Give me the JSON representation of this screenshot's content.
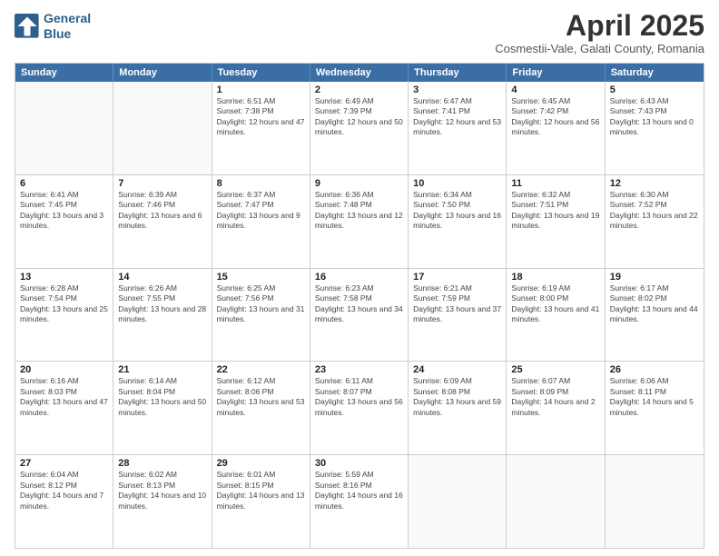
{
  "logo": {
    "line1": "General",
    "line2": "Blue"
  },
  "title": "April 2025",
  "subtitle": "Cosmestii-Vale, Galati County, Romania",
  "header_days": [
    "Sunday",
    "Monday",
    "Tuesday",
    "Wednesday",
    "Thursday",
    "Friday",
    "Saturday"
  ],
  "weeks": [
    [
      {
        "day": "",
        "text": ""
      },
      {
        "day": "",
        "text": ""
      },
      {
        "day": "1",
        "text": "Sunrise: 6:51 AM\nSunset: 7:38 PM\nDaylight: 12 hours and 47 minutes."
      },
      {
        "day": "2",
        "text": "Sunrise: 6:49 AM\nSunset: 7:39 PM\nDaylight: 12 hours and 50 minutes."
      },
      {
        "day": "3",
        "text": "Sunrise: 6:47 AM\nSunset: 7:41 PM\nDaylight: 12 hours and 53 minutes."
      },
      {
        "day": "4",
        "text": "Sunrise: 6:45 AM\nSunset: 7:42 PM\nDaylight: 12 hours and 56 minutes."
      },
      {
        "day": "5",
        "text": "Sunrise: 6:43 AM\nSunset: 7:43 PM\nDaylight: 13 hours and 0 minutes."
      }
    ],
    [
      {
        "day": "6",
        "text": "Sunrise: 6:41 AM\nSunset: 7:45 PM\nDaylight: 13 hours and 3 minutes."
      },
      {
        "day": "7",
        "text": "Sunrise: 6:39 AM\nSunset: 7:46 PM\nDaylight: 13 hours and 6 minutes."
      },
      {
        "day": "8",
        "text": "Sunrise: 6:37 AM\nSunset: 7:47 PM\nDaylight: 13 hours and 9 minutes."
      },
      {
        "day": "9",
        "text": "Sunrise: 6:36 AM\nSunset: 7:48 PM\nDaylight: 13 hours and 12 minutes."
      },
      {
        "day": "10",
        "text": "Sunrise: 6:34 AM\nSunset: 7:50 PM\nDaylight: 13 hours and 16 minutes."
      },
      {
        "day": "11",
        "text": "Sunrise: 6:32 AM\nSunset: 7:51 PM\nDaylight: 13 hours and 19 minutes."
      },
      {
        "day": "12",
        "text": "Sunrise: 6:30 AM\nSunset: 7:52 PM\nDaylight: 13 hours and 22 minutes."
      }
    ],
    [
      {
        "day": "13",
        "text": "Sunrise: 6:28 AM\nSunset: 7:54 PM\nDaylight: 13 hours and 25 minutes."
      },
      {
        "day": "14",
        "text": "Sunrise: 6:26 AM\nSunset: 7:55 PM\nDaylight: 13 hours and 28 minutes."
      },
      {
        "day": "15",
        "text": "Sunrise: 6:25 AM\nSunset: 7:56 PM\nDaylight: 13 hours and 31 minutes."
      },
      {
        "day": "16",
        "text": "Sunrise: 6:23 AM\nSunset: 7:58 PM\nDaylight: 13 hours and 34 minutes."
      },
      {
        "day": "17",
        "text": "Sunrise: 6:21 AM\nSunset: 7:59 PM\nDaylight: 13 hours and 37 minutes."
      },
      {
        "day": "18",
        "text": "Sunrise: 6:19 AM\nSunset: 8:00 PM\nDaylight: 13 hours and 41 minutes."
      },
      {
        "day": "19",
        "text": "Sunrise: 6:17 AM\nSunset: 8:02 PM\nDaylight: 13 hours and 44 minutes."
      }
    ],
    [
      {
        "day": "20",
        "text": "Sunrise: 6:16 AM\nSunset: 8:03 PM\nDaylight: 13 hours and 47 minutes."
      },
      {
        "day": "21",
        "text": "Sunrise: 6:14 AM\nSunset: 8:04 PM\nDaylight: 13 hours and 50 minutes."
      },
      {
        "day": "22",
        "text": "Sunrise: 6:12 AM\nSunset: 8:06 PM\nDaylight: 13 hours and 53 minutes."
      },
      {
        "day": "23",
        "text": "Sunrise: 6:11 AM\nSunset: 8:07 PM\nDaylight: 13 hours and 56 minutes."
      },
      {
        "day": "24",
        "text": "Sunrise: 6:09 AM\nSunset: 8:08 PM\nDaylight: 13 hours and 59 minutes."
      },
      {
        "day": "25",
        "text": "Sunrise: 6:07 AM\nSunset: 8:09 PM\nDaylight: 14 hours and 2 minutes."
      },
      {
        "day": "26",
        "text": "Sunrise: 6:06 AM\nSunset: 8:11 PM\nDaylight: 14 hours and 5 minutes."
      }
    ],
    [
      {
        "day": "27",
        "text": "Sunrise: 6:04 AM\nSunset: 8:12 PM\nDaylight: 14 hours and 7 minutes."
      },
      {
        "day": "28",
        "text": "Sunrise: 6:02 AM\nSunset: 8:13 PM\nDaylight: 14 hours and 10 minutes."
      },
      {
        "day": "29",
        "text": "Sunrise: 6:01 AM\nSunset: 8:15 PM\nDaylight: 14 hours and 13 minutes."
      },
      {
        "day": "30",
        "text": "Sunrise: 5:59 AM\nSunset: 8:16 PM\nDaylight: 14 hours and 16 minutes."
      },
      {
        "day": "",
        "text": ""
      },
      {
        "day": "",
        "text": ""
      },
      {
        "day": "",
        "text": ""
      }
    ]
  ]
}
